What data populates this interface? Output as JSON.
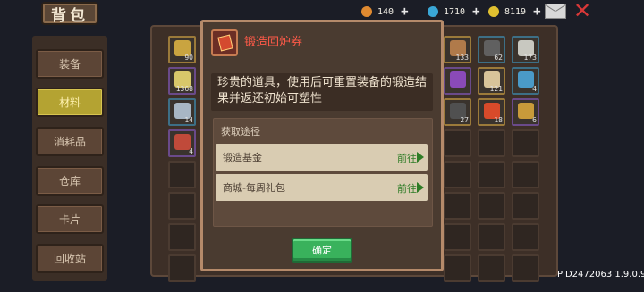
{
  "header": {
    "bag_tab": "背包",
    "resources": [
      {
        "value": "140",
        "icon": "fire-icon",
        "color": "#e08a30"
      },
      {
        "value": "1710",
        "icon": "gem-icon",
        "color": "#3aa7d6"
      },
      {
        "value": "8119",
        "icon": "coin-icon",
        "color": "#e0c030"
      }
    ]
  },
  "sidebar": {
    "items": [
      {
        "label": "装备",
        "active": false
      },
      {
        "label": "材料",
        "active": true
      },
      {
        "label": "消耗品",
        "active": false
      },
      {
        "label": "仓库",
        "active": false
      },
      {
        "label": "卡片",
        "active": false
      },
      {
        "label": "回收站",
        "active": false
      }
    ]
  },
  "inventory": {
    "left_items": [
      {
        "count": "90",
        "icon": "scroll-icon",
        "color": "#c9a440",
        "rarity": "gold"
      },
      {
        "count": "1368",
        "icon": "spiral-icon",
        "color": "#d8c86a",
        "rarity": "purple"
      },
      {
        "count": "14",
        "icon": "hammer-icon",
        "color": "#a8b6c4",
        "rarity": "blue"
      },
      {
        "count": "4",
        "icon": "crystal-icon",
        "color": "#c04a3a",
        "rarity": "purple"
      }
    ],
    "right_items": [
      {
        "count": "133",
        "icon": "horn-icon",
        "color": "#b07a4a",
        "rarity": "gold"
      },
      {
        "count": "62",
        "icon": "stone-icon",
        "color": "#606060",
        "rarity": "blue"
      },
      {
        "count": "173",
        "icon": "feather-icon",
        "color": "#c8c8c0",
        "rarity": "blue"
      },
      {
        "count": "",
        "icon": "gem-purple-icon",
        "color": "#8a4ab8",
        "rarity": "purple"
      },
      {
        "count": "121",
        "icon": "fang-icon",
        "color": "#d8c49a",
        "rarity": "gold"
      },
      {
        "count": "4",
        "icon": "armor-icon",
        "color": "#4a9ac8",
        "rarity": "blue"
      },
      {
        "count": "27",
        "icon": "pickaxe-icon",
        "color": "#505050",
        "rarity": "gold"
      },
      {
        "count": "18",
        "icon": "flame-icon",
        "color": "#d84a2a",
        "rarity": "gold"
      },
      {
        "count": "6",
        "icon": "map-icon",
        "color": "#c89a3a",
        "rarity": "purple"
      }
    ]
  },
  "modal": {
    "title": "锻造回炉券",
    "icon": "ticket-icon",
    "description": "珍贵的道具，使用后可重置装备的锻造结果并返还初始可塑性",
    "source_header": "获取途径",
    "sources": [
      {
        "label": "锻造基金",
        "action": "前往"
      },
      {
        "label": "商城-每周礼包",
        "action": "前往"
      }
    ],
    "confirm_label": "确定"
  },
  "footer": {
    "pid_version": "PID2472063 1.9.0.9"
  }
}
